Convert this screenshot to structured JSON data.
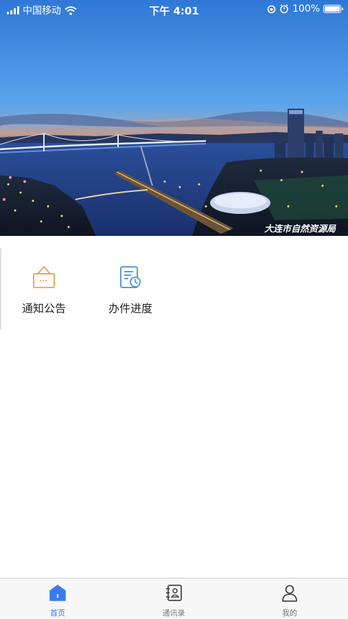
{
  "status_bar": {
    "carrier": "中国移动",
    "time": "下午 4:01",
    "battery": "100%"
  },
  "banner": {
    "watermark": "大连市自然资源局"
  },
  "menu": {
    "items": [
      {
        "label": "通知公告",
        "icon": "notice-icon"
      },
      {
        "label": "办件进度",
        "icon": "progress-icon"
      }
    ]
  },
  "tab_bar": {
    "tabs": [
      {
        "label": "首页",
        "icon": "home-icon",
        "active": true
      },
      {
        "label": "通讯录",
        "icon": "contacts-icon",
        "active": false
      },
      {
        "label": "我的",
        "icon": "user-icon",
        "active": false
      }
    ]
  },
  "colors": {
    "accent": "#3a7bf0",
    "notice_icon": "#e8a14a",
    "progress_icon": "#4a8fd8",
    "inactive": "#555555"
  }
}
